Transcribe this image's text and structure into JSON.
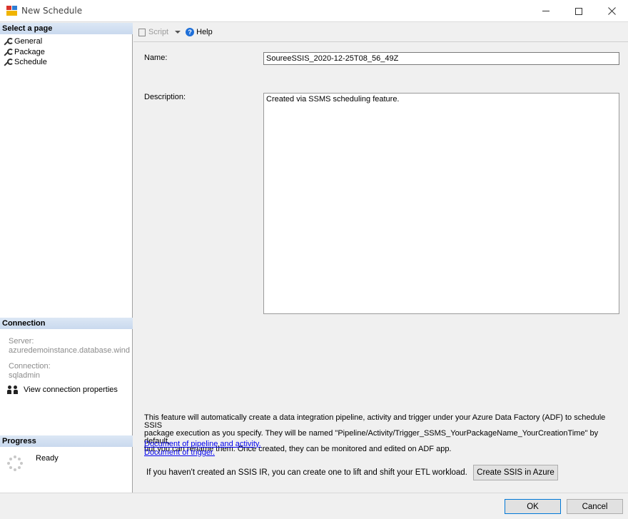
{
  "window": {
    "title": "New Schedule",
    "icons": [
      "app-icon",
      "minimize-icon",
      "maximize-icon",
      "close-icon"
    ]
  },
  "select_page": {
    "header": "Select a page",
    "items": [
      {
        "label": "General",
        "icon": "wrench-icon"
      },
      {
        "label": "Package",
        "icon": "wrench-icon"
      },
      {
        "label": "Schedule",
        "icon": "wrench-icon"
      }
    ]
  },
  "connection": {
    "header": "Connection",
    "server_label": "Server:",
    "server_value": "azuredemoinstance.database.wind",
    "connection_label": "Connection:",
    "connection_value": "sqladmin",
    "view_properties": "View connection properties"
  },
  "progress": {
    "header": "Progress",
    "status": "Ready"
  },
  "toolbar": {
    "script_label": "Script",
    "help_label": "Help"
  },
  "form": {
    "name_label": "Name:",
    "name_value": "SoureeSSIS_2020-12-25T08_56_49Z",
    "description_label": "Description:",
    "description_value": "Created via SSMS scheduling feature."
  },
  "info": {
    "line1": "This feature will automatically create a data integration pipeline, activity and trigger under your Azure Data Factory (ADF) to schedule SSIS",
    "line2": "package execution as you specify. They will be named \"Pipeline/Activity/Trigger_SSMS_YourPackageName_YourCreationTime\" by default,",
    "line3": "but you can rename them. Once created, they can be monitored and edited on ADF app.",
    "link_pipeline": "Document of pipeline and activity.",
    "link_trigger": "Document of trigger.",
    "ir_text": "If you haven't created an SSIS IR, you can create one to lift and shift your ETL workload.",
    "create_button": "Create SSIS in Azure"
  },
  "buttons": {
    "ok": "OK",
    "cancel": "Cancel"
  }
}
